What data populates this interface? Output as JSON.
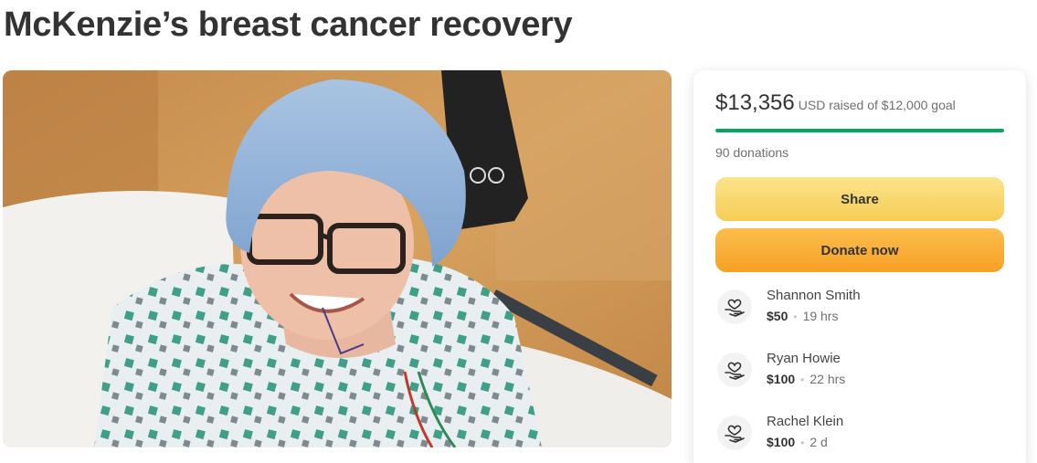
{
  "campaign": {
    "title": "McKenzie’s breast cancer recovery"
  },
  "donation_card": {
    "raised_amount": "$13,356",
    "raised_rest": "USD raised of $12,000 goal",
    "progress_fraction": 1.0,
    "donation_count": "90 donations",
    "share_label": "Share",
    "donate_label": "Donate now",
    "colors": {
      "progress": "#02a95c",
      "share_button": "#f6cc55",
      "donate_button": "#f5a125"
    },
    "donors": [
      {
        "name": "Shannon Smith",
        "amount": "$50",
        "time": "19 hrs",
        "icon": "heart-hand-icon"
      },
      {
        "name": "Ryan Howie",
        "amount": "$100",
        "time": "22 hrs",
        "icon": "heart-hand-icon"
      },
      {
        "name": "Rachel Klein",
        "amount": "$100",
        "time": "2 d",
        "icon": "heart-hand-icon"
      }
    ]
  }
}
